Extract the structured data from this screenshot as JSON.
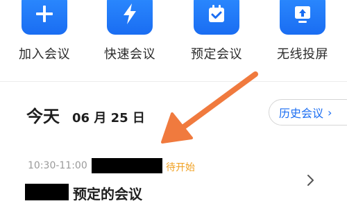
{
  "quick_actions": [
    {
      "label": "加入会议",
      "icon": "plus-icon"
    },
    {
      "label": "快速会议",
      "icon": "lightning-icon"
    },
    {
      "label": "预定会议",
      "icon": "calendar-check-icon"
    },
    {
      "label": "无线投屏",
      "icon": "screen-cast-icon"
    }
  ],
  "schedule": {
    "today_label": "今天",
    "date": "06 月 25 日",
    "history_button": "历史会议"
  },
  "meeting": {
    "time": "10:30-11:00",
    "status": "待开始",
    "title": "预定的会议"
  },
  "colors": {
    "accent_blue": "#1a6df2",
    "status_orange": "#f0a020",
    "annotation_arrow": "#f07a3e"
  }
}
